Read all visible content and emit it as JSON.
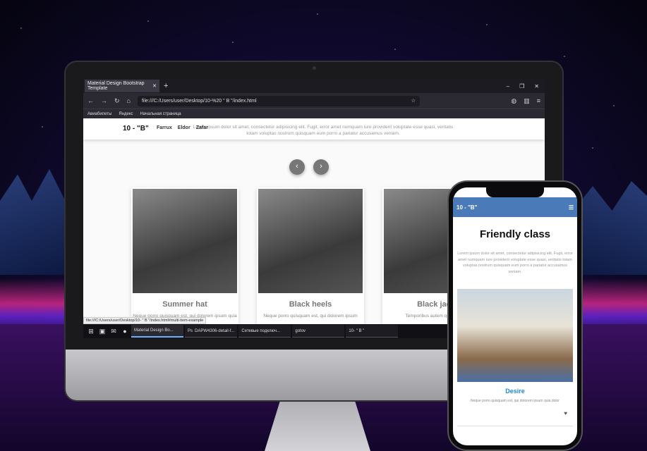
{
  "browser": {
    "tab_title": "Material Design Bootstrap Template",
    "tab_close": "✕",
    "new_tab": "+",
    "window_controls": [
      "–",
      "❐",
      "✕"
    ],
    "url": "file:///C:/Users/user/Desktop/10-%20 \" B \"/index.html",
    "bookmarks": [
      "Авиабилеты",
      "Яндекс",
      "Начальная страница"
    ],
    "status_url": "file:///C:/Users/user/Desktop/10- \" B \"/index.html#multi-item-example"
  },
  "site": {
    "brand": "10 - \"B\"",
    "nav_links": [
      "Farrux",
      "Eldor",
      "Zafar"
    ],
    "nav_text": "Lorem ipsum dolor sit amet, consectetur adipisicing elit. Fugit, error amet numquam iure provident voluptate esse quasi, veritatis totam voluptas nostrum quisquam eum porro a pariatur accusamus veniam.",
    "prev_arrow": "‹",
    "next_arrow": "›",
    "cards": [
      {
        "title": "Summer hat",
        "text": "Neque porro quisquam est, qui dolorem ipsum quia dolor"
      },
      {
        "title": "Black heels",
        "text": "Neque porro quisquam est, qui dolorem ipsum"
      },
      {
        "title": "Black jack",
        "text": "Temporibus autem quibusdam"
      }
    ]
  },
  "taskbar": {
    "items": [
      "Material Design Bo...",
      "DAPW4306-detail-f...",
      "Сетевые подключ...",
      "gotov",
      "10- \" B \""
    ]
  },
  "phone": {
    "brand": "10 - \"B\"",
    "menu_icon": "☰",
    "title": "Friendly class",
    "text": "Lorem ipsum dolor sit amet, consectetur adipisicing elit. Fugit, error amet numquam iure provident voluptate esse quasi, veritatis totam voluptas nostrum quisquam eum porro a pariatur accusamus veniam.",
    "card_title": "Desire",
    "card_text": "Neque porro quisquam est, qui dolorem ipsum quia dolor",
    "heart": "♥"
  }
}
